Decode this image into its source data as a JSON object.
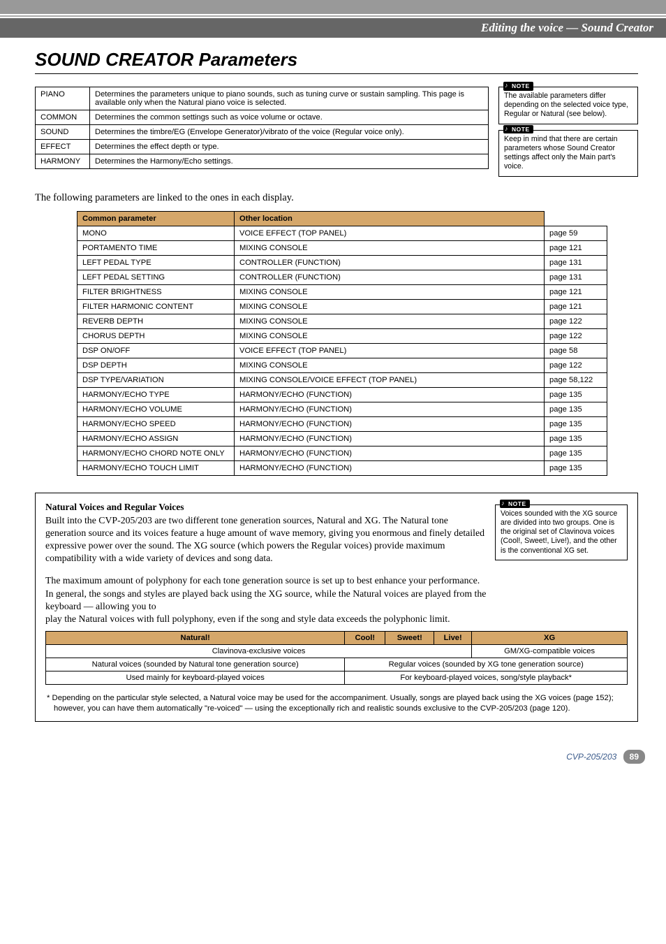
{
  "breadcrumb": "Editing the voice  — Sound Creator",
  "title": "SOUND CREATOR Parameters",
  "param_table": [
    {
      "name": "PIANO",
      "desc": "Determines the parameters unique to piano sounds, such as tuning curve or sustain sampling. This page is available only when the Natural piano voice is selected."
    },
    {
      "name": "COMMON",
      "desc": "Determines the common settings such as voice volume or octave."
    },
    {
      "name": "SOUND",
      "desc": "Determines the timbre/EG (Envelope Generator)/vibrato of the voice (Regular voice only)."
    },
    {
      "name": "EFFECT",
      "desc": "Determines the effect depth or type."
    },
    {
      "name": "HARMONY",
      "desc": "Determines the Harmony/Echo settings."
    }
  ],
  "note1": "The available parameters differ depending on the selected voice type, Regular or Natural (see below).",
  "note2": "Keep in mind that there are certain parameters whose Sound Creator settings affect only the Main part's voice.",
  "note_label": "NOTE",
  "linked_text": "The following parameters are linked to the ones in each display.",
  "link_headers": {
    "a": "Common parameter",
    "b": "Other location"
  },
  "link_table": [
    {
      "p": "MONO",
      "loc": "VOICE EFFECT (TOP PANEL)",
      "pg": "page 59"
    },
    {
      "p": "PORTAMENTO TIME",
      "loc": "MIXING CONSOLE",
      "pg": "page 121"
    },
    {
      "p": "LEFT PEDAL TYPE",
      "loc": "CONTROLLER (FUNCTION)",
      "pg": "page 131"
    },
    {
      "p": "LEFT PEDAL SETTING",
      "loc": "CONTROLLER (FUNCTION)",
      "pg": "page 131"
    },
    {
      "p": "FILTER BRIGHTNESS",
      "loc": "MIXING CONSOLE",
      "pg": "page 121"
    },
    {
      "p": "FILTER HARMONIC CONTENT",
      "loc": "MIXING CONSOLE",
      "pg": "page 121"
    },
    {
      "p": "REVERB DEPTH",
      "loc": "MIXING CONSOLE",
      "pg": "page 122"
    },
    {
      "p": "CHORUS DEPTH",
      "loc": "MIXING CONSOLE",
      "pg": "page 122"
    },
    {
      "p": "DSP ON/OFF",
      "loc": "VOICE EFFECT (TOP PANEL)",
      "pg": "page 58"
    },
    {
      "p": "DSP DEPTH",
      "loc": "MIXING CONSOLE",
      "pg": "page 122"
    },
    {
      "p": "DSP TYPE/VARIATION",
      "loc": "MIXING CONSOLE/VOICE EFFECT (TOP PANEL)",
      "pg": "page 58,122"
    },
    {
      "p": "HARMONY/ECHO TYPE",
      "loc": "HARMONY/ECHO (FUNCTION)",
      "pg": "page 135"
    },
    {
      "p": "HARMONY/ECHO VOLUME",
      "loc": "HARMONY/ECHO (FUNCTION)",
      "pg": "page 135"
    },
    {
      "p": "HARMONY/ECHO SPEED",
      "loc": "HARMONY/ECHO (FUNCTION)",
      "pg": "page 135"
    },
    {
      "p": "HARMONY/ECHO ASSIGN",
      "loc": "HARMONY/ECHO (FUNCTION)",
      "pg": "page 135"
    },
    {
      "p": "HARMONY/ECHO CHORD NOTE ONLY",
      "loc": "HARMONY/ECHO (FUNCTION)",
      "pg": "page 135"
    },
    {
      "p": "HARMONY/ECHO TOUCH LIMIT",
      "loc": "HARMONY/ECHO (FUNCTION)",
      "pg": "page 135"
    }
  ],
  "info": {
    "title": "Natural Voices and Regular Voices",
    "p1": "Built into the CVP-205/203 are two different tone generation sources, Natural and XG. The Natural tone generation source and its voices feature a huge amount of wave memory, giving you enormous and finely detailed expressive power over the sound. The XG source (which powers the Regular voices) provide maximum compatibility with a wide variety of devices and song data.",
    "p2": "The maximum amount of polyphony for each tone generation source is set up to best enhance your performance. In general, the songs and styles are played back using the XG source, while the Natural voices are played from the keyboard — allowing you to play the Natural voices with full polyphony, even if the song and style data exceeds the polyphonic limit.",
    "note": "Voices sounded with the XG source are divided into two groups. One is the original set of Clavinova voices (Cool!, Sweet!, Live!), and the other is the conventional XG set."
  },
  "voice_table": {
    "headers": [
      "Natural!",
      "Cool!",
      "Sweet!",
      "Live!",
      "XG"
    ],
    "row1": [
      "Clavinova-exclusive voices",
      "GM/XG-compatible voices"
    ],
    "row2": [
      "Natural voices (sounded by Natural tone generation source)",
      "Regular voices (sounded by XG tone generation source)"
    ],
    "row3": [
      "Used mainly for keyboard-played voices",
      "For keyboard-played voices, song/style playback*"
    ]
  },
  "footnote": "*  Depending on the particular style selected, a Natural voice may be used for the accompaniment. Usually, songs are played back using the XG voices (page 152); however, you can have them automatically \"re-voiced\" — using the exceptionally rich and realistic sounds exclusive to the CVP-205/203 (page 120).",
  "footer": {
    "model": "CVP-205/203",
    "page": "89"
  }
}
